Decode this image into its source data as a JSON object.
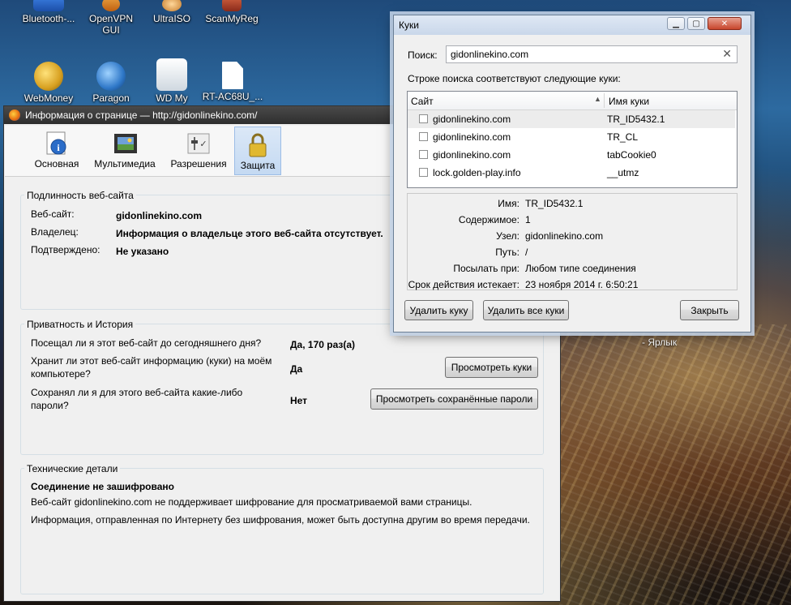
{
  "desktop": {
    "icons": [
      {
        "label": "Bluetooth-...",
        "icon": "bluetooth-icon"
      },
      {
        "label": "OpenVPN GUI",
        "icon": "openvpn-icon"
      },
      {
        "label": "UltraISO",
        "icon": "ultraiso-icon"
      },
      {
        "label": "ScanMyReg",
        "icon": "scanmyreg-icon"
      },
      {
        "label": "WebMoney",
        "icon": "webmoney-icon"
      },
      {
        "label": "Paragon",
        "icon": "paragon-icon"
      },
      {
        "label": "WD My",
        "icon": "wd-icon"
      },
      {
        "label": "RT-AC68U_...",
        "icon": "file-icon"
      }
    ],
    "shortcut_label": "- Ярлык"
  },
  "pageinfo": {
    "title": "Информация о странице — http://gidonlinekino.com/",
    "toolbar": [
      {
        "label": "Основная",
        "icon": "info-icon"
      },
      {
        "label": "Мультимедиа",
        "icon": "media-icon"
      },
      {
        "label": "Разрешения",
        "icon": "permissions-icon"
      },
      {
        "label": "Защита",
        "icon": "lock-icon"
      }
    ],
    "identity": {
      "title": "Подлинность веб-сайта",
      "website_label": "Веб-сайт:",
      "website_value": "gidonlinekino.com",
      "owner_label": "Владелец:",
      "owner_value": "Информация о владельце этого веб-сайта отсутствует.",
      "verified_label": "Подтверждено:",
      "verified_value": "Не указано"
    },
    "privacy": {
      "title": "Приватность и История",
      "q1": "Посещал ли я этот веб-сайт до сегодняшнего дня?",
      "a1": "Да, 170 раз(а)",
      "q2_line1": "Хранит ли этот веб-сайт информацию (куки) на моём",
      "q2_line2": "компьютере?",
      "a2": "Да",
      "view_cookies": "Просмотреть куки",
      "q3_line1": "Сохранял ли я для этого веб-сайта какие-либо",
      "q3_line2": "пароли?",
      "a3": "Нет",
      "view_passwords": "Просмотреть сохранённые пароли"
    },
    "technical": {
      "title": "Технические детали",
      "heading": "Соединение не зашифровано",
      "line1": "Веб-сайт gidonlinekino.com не поддерживает шифрование для просматриваемой вами страницы.",
      "line2": "Информация, отправленная по Интернету без шифрования, может быть доступна другим во время передачи."
    }
  },
  "cookies": {
    "title": "Куки",
    "search_label": "Поиск:",
    "search_value": "gidonlinekino.com",
    "match_text": "Строке поиска соответствуют следующие куки:",
    "col_site": "Сайт",
    "col_name": "Имя куки",
    "rows": [
      {
        "site": "gidonlinekino.com",
        "name": "TR_ID5432.1"
      },
      {
        "site": "gidonlinekino.com",
        "name": "TR_CL"
      },
      {
        "site": "gidonlinekino.com",
        "name": "tabCookie0"
      },
      {
        "site": "lock.golden-play.info",
        "name": "__utmz"
      }
    ],
    "details": {
      "name_label": "Имя:",
      "name_value": "TR_ID5432.1",
      "content_label": "Содержимое:",
      "content_value": "1",
      "host_label": "Узел:",
      "host_value": "gidonlinekino.com",
      "path_label": "Путь:",
      "path_value": "/",
      "send_label": "Посылать при:",
      "send_value": "Любом типе соединения",
      "expires_label": "Срок действия истекает:",
      "expires_value": "23 ноября 2014 г. 6:50:21"
    },
    "btn_delete": "Удалить куку",
    "btn_delete_all": "Удалить все куки",
    "btn_close": "Закрыть"
  }
}
